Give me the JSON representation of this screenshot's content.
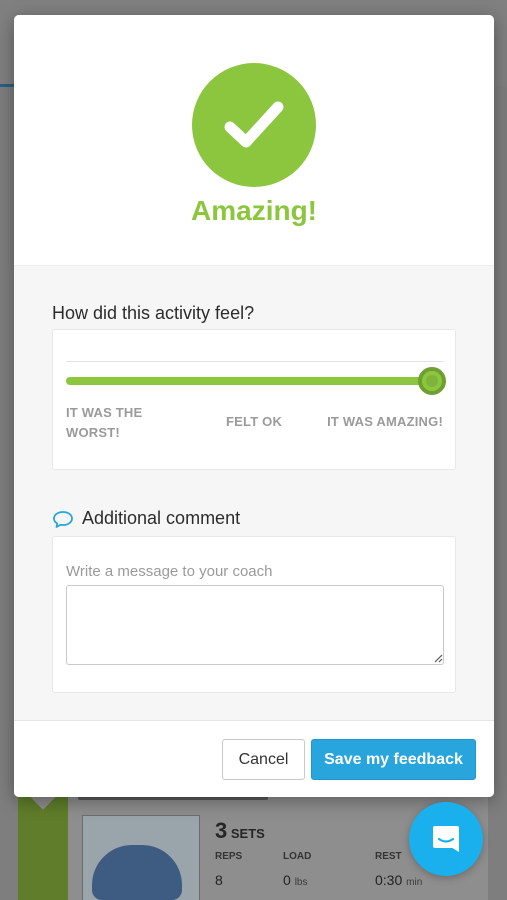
{
  "background_workout": {
    "sets_count": "3",
    "sets_label": "SETS",
    "columns": [
      "REPS",
      "LOAD",
      "REST"
    ],
    "values": {
      "reps": "8",
      "load": "0",
      "load_unit": "lbs",
      "rest": "0:30",
      "rest_unit": "min"
    }
  },
  "modal": {
    "result_icon": "checkmark-icon",
    "result_title": "Amazing!",
    "question": "How did this activity feel?",
    "feel_scale": {
      "low_label": "IT WAS THE WORST!",
      "mid_label": "FELT OK",
      "high_label": "IT WAS AMAZING!",
      "value_fraction": 1.0
    },
    "comment": {
      "icon": "speech-bubble-icon",
      "heading": "Additional comment",
      "prompt": "Write a message to your coach",
      "value": ""
    },
    "buttons": {
      "cancel": "Cancel",
      "save": "Save my feedback"
    }
  },
  "chat_launcher": {
    "icon": "chat-icon"
  },
  "colors": {
    "accent_green": "#8cc63f",
    "primary_blue": "#27a5dc",
    "chat_blue": "#1ab0ed"
  }
}
